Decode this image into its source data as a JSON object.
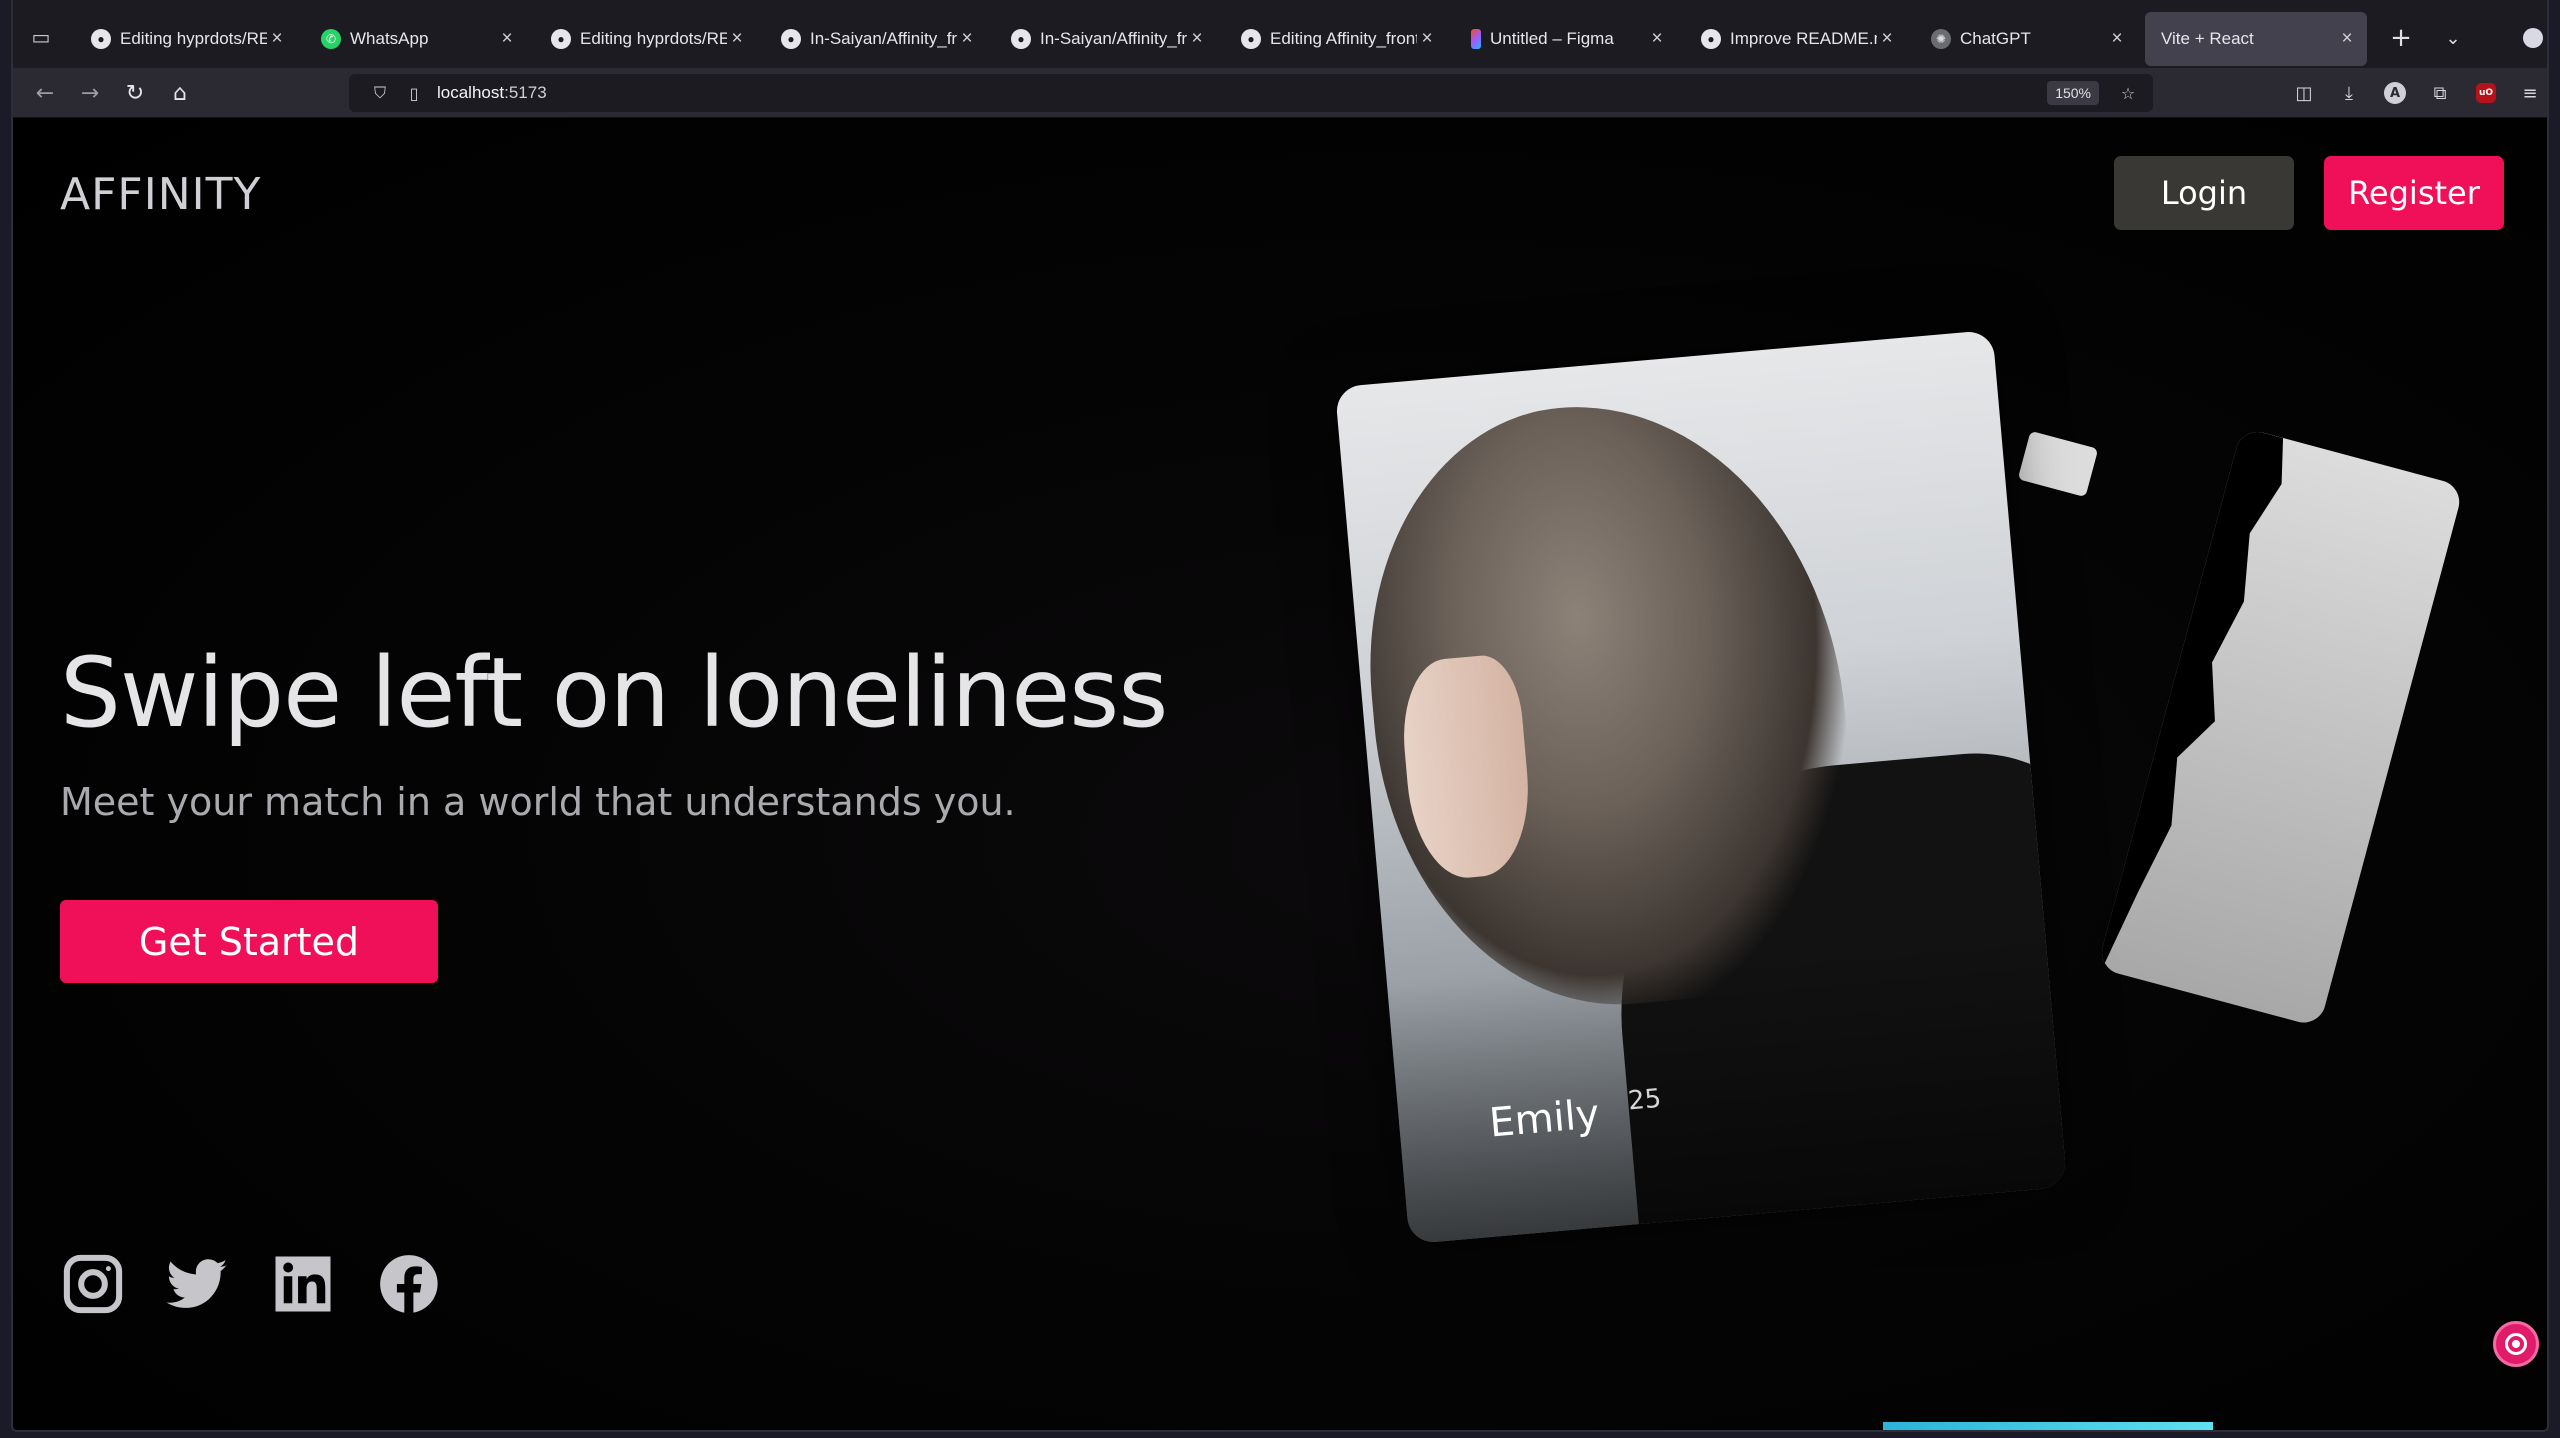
{
  "browser": {
    "tabs": [
      {
        "title": "Editing hyprdots/REA",
        "icon": "github-icon",
        "active": false
      },
      {
        "title": "WhatsApp",
        "icon": "whatsapp-icon",
        "active": false
      },
      {
        "title": "Editing hyprdots/REA",
        "icon": "github-icon",
        "active": false
      },
      {
        "title": "In-Saiyan/Affinity_fro",
        "icon": "github-icon",
        "active": false
      },
      {
        "title": "In-Saiyan/Affinity_fro",
        "icon": "github-icon",
        "active": false
      },
      {
        "title": "Editing Affinity_front",
        "icon": "github-icon",
        "active": false
      },
      {
        "title": "Untitled – Figma",
        "icon": "figma-icon",
        "active": false
      },
      {
        "title": "Improve README.mc",
        "icon": "github-icon",
        "active": false
      },
      {
        "title": "ChatGPT",
        "icon": "chatgpt-icon",
        "active": false
      },
      {
        "title": "Vite + React",
        "icon": "none",
        "active": true
      }
    ],
    "url": "localhost:5173",
    "url_host": "localhost",
    "url_port": ":5173",
    "zoom": "150%"
  },
  "page": {
    "logo": "AFFINITY",
    "login_label": "Login",
    "register_label": "Register",
    "headline": "Swipe left on loneliness",
    "subline": "Meet your match in a world that understands you.",
    "cta_label": "Get Started",
    "card": {
      "name": "Emily",
      "age": "25"
    },
    "socials": [
      "instagram-icon",
      "twitter-icon",
      "linkedin-icon",
      "facebook-icon"
    ]
  },
  "colors": {
    "accent": "#f0105a",
    "login_bg": "#3a3834",
    "background": "#000000"
  }
}
